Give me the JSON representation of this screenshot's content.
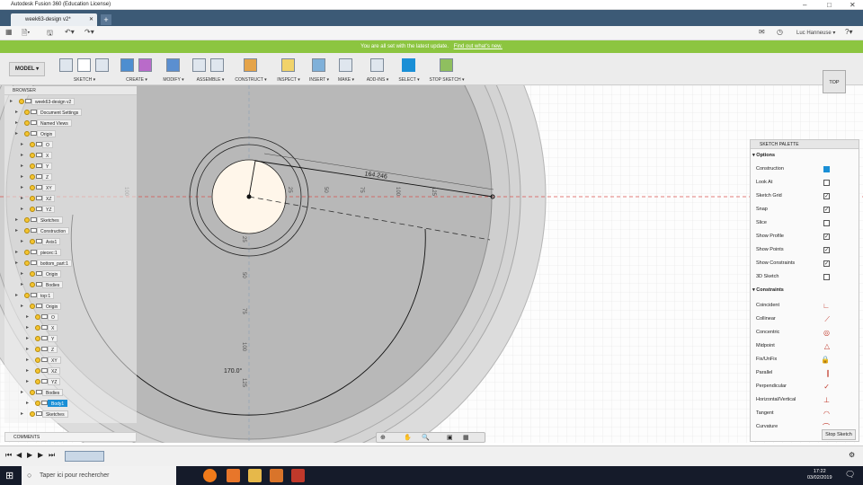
{
  "title_bar": {
    "title": "Autodesk Fusion 360 (Education License)",
    "minimize": "–",
    "maximize": "□",
    "close": "✕"
  },
  "tabs": {
    "doc_tab": "week63-design v2*",
    "new_tab": "+"
  },
  "quick_access": {
    "grid": "▦",
    "file": "🗎▾",
    "save": "🖫",
    "undo": "↶▾",
    "redo": "↷▾",
    "user": "Luc Hanneuse ▾",
    "help": "?▾",
    "jobs": "✉",
    "clock": "◷"
  },
  "notification": {
    "text": "You are all set with the latest update.",
    "link": "Find out what's new."
  },
  "ribbon": {
    "workspace": "MODEL ▾",
    "groups": [
      "SKETCH ▾",
      "CREATE ▾",
      "MODIFY ▾",
      "ASSEMBLE ▾",
      "CONSTRUCT ▾",
      "INSPECT ▾",
      "INSERT ▾",
      "MAKE ▾",
      "ADD-INS ▾",
      "SELECT ▾",
      "STOP SKETCH ▾"
    ]
  },
  "viewcube": {
    "face": "TOP"
  },
  "browser": {
    "header": "BROWSER",
    "nodes": [
      {
        "label": "week63-design v2",
        "indent": 0
      },
      {
        "label": "Document Settings",
        "indent": 1
      },
      {
        "label": "Named Views",
        "indent": 1
      },
      {
        "label": "Origin",
        "indent": 1
      },
      {
        "label": "O",
        "indent": 2
      },
      {
        "label": "X",
        "indent": 2
      },
      {
        "label": "Y",
        "indent": 2
      },
      {
        "label": "Z",
        "indent": 2
      },
      {
        "label": "XY",
        "indent": 2
      },
      {
        "label": "XZ",
        "indent": 2
      },
      {
        "label": "YZ",
        "indent": 2
      },
      {
        "label": "Sketches",
        "indent": 1
      },
      {
        "label": "Construction",
        "indent": 1
      },
      {
        "label": "Axis1",
        "indent": 2
      },
      {
        "label": "piecec:1",
        "indent": 1
      },
      {
        "label": "bottom_part:1",
        "indent": 1
      },
      {
        "label": "Origin",
        "indent": 2
      },
      {
        "label": "Bodies",
        "indent": 2
      },
      {
        "label": "top:1",
        "indent": 1
      },
      {
        "label": "Origin",
        "indent": 2
      },
      {
        "label": "O",
        "indent": 3
      },
      {
        "label": "X",
        "indent": 3
      },
      {
        "label": "Y",
        "indent": 3
      },
      {
        "label": "Z",
        "indent": 3
      },
      {
        "label": "XY",
        "indent": 3
      },
      {
        "label": "XZ",
        "indent": 3
      },
      {
        "label": "YZ",
        "indent": 3
      },
      {
        "label": "Bodies",
        "indent": 2
      },
      {
        "label": "Body1",
        "indent": 3
      },
      {
        "label": "Sketches",
        "indent": 2
      }
    ]
  },
  "comments": {
    "label": "COMMENTS"
  },
  "sketch": {
    "dim_line": "164.246",
    "dim_angle": "170.0°",
    "ticks_vertical": [
      "25",
      "50",
      "75",
      "100",
      "125"
    ],
    "ticks_diag": [
      "25",
      "50",
      "75",
      "100",
      "125"
    ],
    "ticks_horiz": [
      "100"
    ]
  },
  "palette": {
    "header": "SKETCH PALETTE",
    "options_title": "Options",
    "options": [
      {
        "label": "Construction",
        "state": "blue"
      },
      {
        "label": "Look At",
        "state": "icon"
      },
      {
        "label": "Sketch Grid",
        "state": "on"
      },
      {
        "label": "Snap",
        "state": "on"
      },
      {
        "label": "Slice",
        "state": "off"
      },
      {
        "label": "Show Profile",
        "state": "on"
      },
      {
        "label": "Show Points",
        "state": "on"
      },
      {
        "label": "Show Constraints",
        "state": "on"
      },
      {
        "label": "3D Sketch",
        "state": "off"
      }
    ],
    "constraints_title": "Constraints",
    "constraints": [
      {
        "label": "Coincident",
        "icon": "∟"
      },
      {
        "label": "Collinear",
        "icon": "⟋"
      },
      {
        "label": "Concentric",
        "icon": "◎"
      },
      {
        "label": "Midpoint",
        "icon": "△"
      },
      {
        "label": "Fix/UnFix",
        "icon": "🔒"
      },
      {
        "label": "Parallel",
        "icon": "∥"
      },
      {
        "label": "Perpendicular",
        "icon": "✓"
      },
      {
        "label": "Horizontal/Vertical",
        "icon": "⊥"
      },
      {
        "label": "Tangent",
        "icon": "◠"
      },
      {
        "label": "Curvature",
        "icon": "⌒"
      }
    ],
    "stop_button": "Stop Sketch"
  },
  "timeline": {
    "first": "⏮",
    "prev": "◀",
    "play": "▶",
    "next": "▶",
    "last": "⏭",
    "settings": "⚙"
  },
  "taskbar": {
    "search_placeholder": "Taper ici pour rechercher",
    "time": "17:22",
    "date": "03/02/2019"
  }
}
